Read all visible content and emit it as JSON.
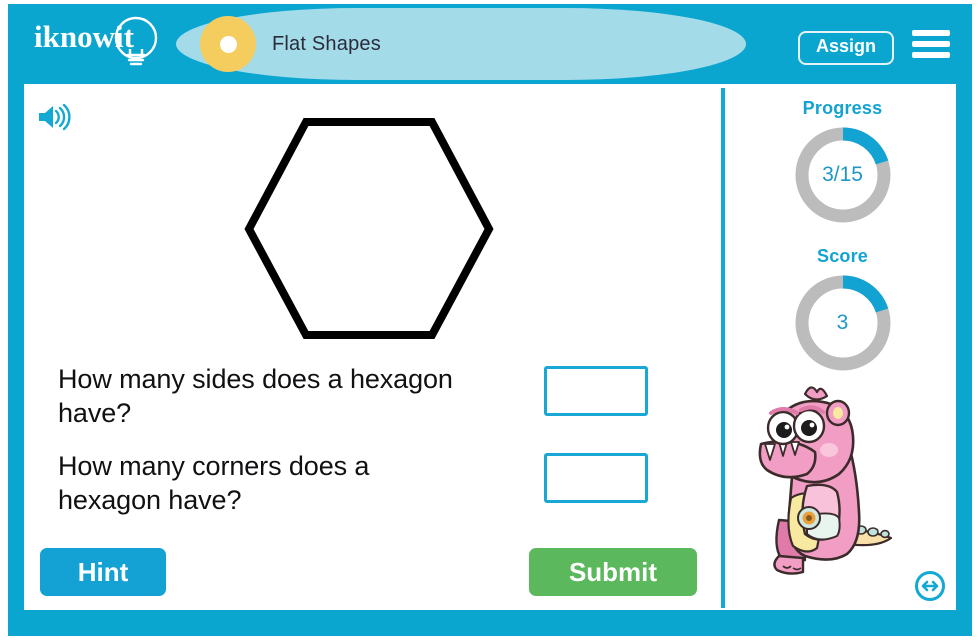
{
  "header": {
    "logo_text": "iknowit",
    "logo_icon": "lightbulb-icon",
    "lesson_title": "Flat Shapes",
    "assign_label": "Assign",
    "menu_icon": "hamburger-menu-icon",
    "bar_color": "#0aa6d0",
    "tab_color": "#a4dbe9",
    "dot_color": "#f5cd5f"
  },
  "content": {
    "audio_icon": "speaker-icon",
    "shape": {
      "name": "hexagon-shape",
      "sides": 6,
      "stroke_color": "#000000"
    },
    "questions": [
      {
        "text": "How many sides does a hexagon have?",
        "answer": "",
        "placeholder": ""
      },
      {
        "text": "How many corners does a hexagon have?",
        "answer": "",
        "placeholder": ""
      }
    ],
    "hint_label": "Hint",
    "submit_label": "Submit",
    "hint_color": "#14a2d4",
    "submit_color": "#5cb85c",
    "input_border_color": "#19a7d6"
  },
  "sidebar": {
    "progress": {
      "label": "Progress",
      "value": "3/15",
      "completed": 3,
      "total": 15,
      "percent": 20,
      "arc_color": "#12a3d2",
      "track_color": "#bcbcbc"
    },
    "score": {
      "label": "Score",
      "value": "3",
      "points": 3,
      "percent": 20,
      "arc_color": "#12a3d2",
      "track_color": "#bcbcbc"
    },
    "mascot": {
      "name": "pink-monster-mascot",
      "body_color": "#f29dc4",
      "belly_color": "#f7e9a0"
    },
    "resize_icon": "resize-horizontal-icon"
  }
}
